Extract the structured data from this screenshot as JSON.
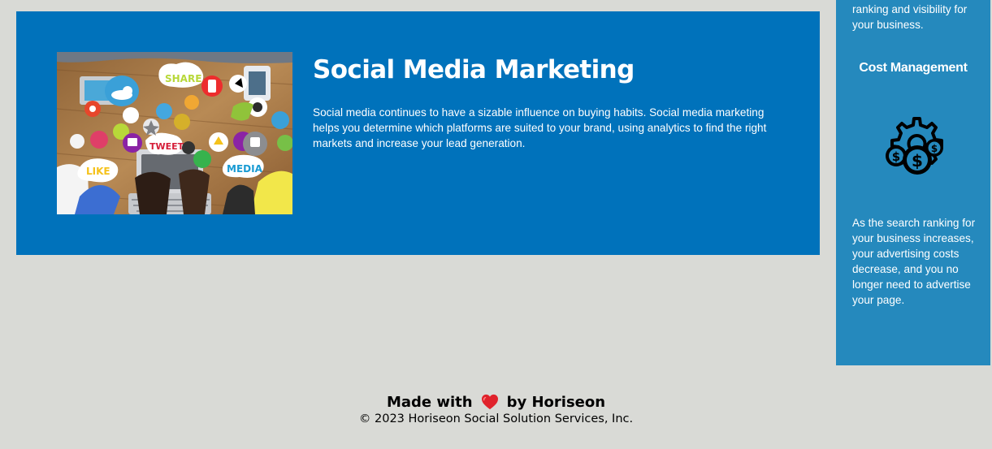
{
  "card": {
    "image_alt": "Social media marketing collage",
    "title": "Social Media Marketing",
    "description": "Social media continues to have a sizable influence on buying habits. Social media marketing helps you determine which platforms are suited to your brand, using analytics to find the right markets and increase your lead generation.",
    "image_labels": {
      "share": "SHARE",
      "tweet": "TWEET",
      "like": "LIKE",
      "media": "MEDIA"
    }
  },
  "sidebar": {
    "top_text": "ranking and visibility for your business.",
    "heading": "Cost Management",
    "icon": "cost-management-icon",
    "bottom_text": "As the search ranking for your business increases, your advertising costs decrease, and you no longer need to advertise your page."
  },
  "footer": {
    "made_with": "Made with",
    "by": "by Horiseon",
    "heart_icon": "heart-icon",
    "copyright": "© 2023 Horiseon Social Solution Services, Inc."
  },
  "colors": {
    "page_background": "#d9dad6",
    "card_background": "#0072bb",
    "sidebar_background": "#2589bd",
    "heart": "#e0222b"
  }
}
